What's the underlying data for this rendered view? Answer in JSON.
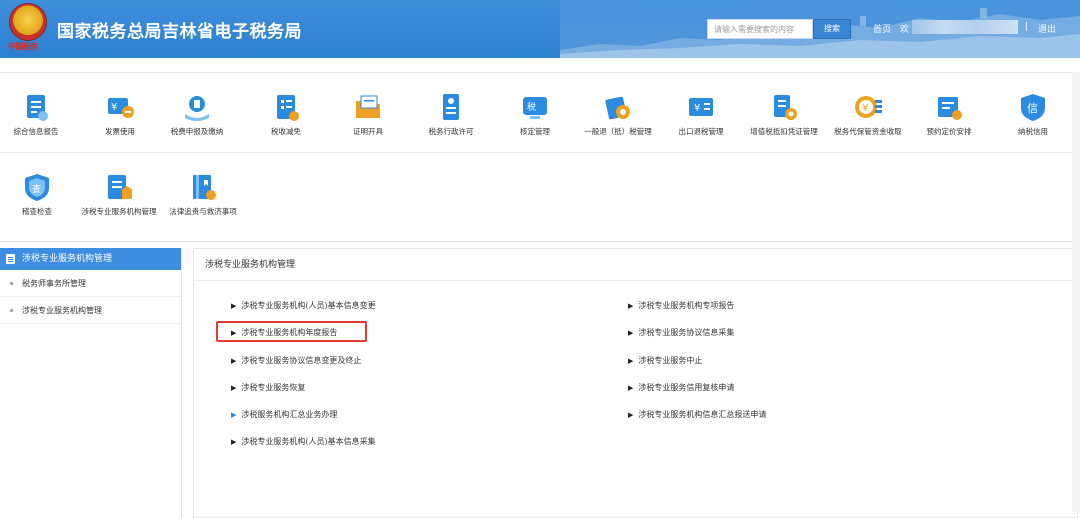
{
  "header": {
    "site_title": "国家税务总局吉林省电子税务局",
    "emblem_caption": "中国税务",
    "search_placeholder": "请输入需要搜索的内容",
    "search_button": "搜索",
    "nav_home": "首页",
    "nav_user_prefix": "欢",
    "nav_separator": "|",
    "nav_logout": "退出"
  },
  "toolbar": {
    "row1": [
      {
        "label": "综合信息报告",
        "icon": "report-icon",
        "color": "#2a8be0"
      },
      {
        "label": "发票使用",
        "icon": "invoice-icon",
        "color": "#2a8be0"
      },
      {
        "label": "税费申报及缴纳",
        "icon": "tax-declare-icon",
        "color": "#2a8be0"
      },
      {
        "label": "税收减免",
        "icon": "tax-reduction-icon",
        "color": "#2a8be0"
      },
      {
        "label": "证明开具",
        "icon": "certificate-icon",
        "color": "#f0a020"
      },
      {
        "label": "税务行政许可",
        "icon": "admin-license-icon",
        "color": "#2a8be0"
      },
      {
        "label": "核定管理",
        "icon": "assessment-icon",
        "color": "#2a8be0"
      },
      {
        "label": "一般退（抵）税管理",
        "icon": "refund-icon",
        "color": "#2a8be0"
      },
      {
        "label": "出口退税管理",
        "icon": "export-refund-icon",
        "color": "#2a8be0"
      },
      {
        "label": "增值税抵扣凭证管理",
        "icon": "vat-voucher-icon",
        "color": "#2a8be0"
      },
      {
        "label": "税务代保管资金收取",
        "icon": "custody-fund-icon",
        "color": "#f0a020"
      },
      {
        "label": "预约定价安排",
        "icon": "pricing-arrangement-icon",
        "color": "#2a8be0"
      },
      {
        "label": "纳税信用",
        "icon": "credit-icon",
        "color": "#2a8be0"
      }
    ],
    "row2": [
      {
        "label": "稽查检查",
        "icon": "inspection-icon",
        "color": "#2a8be0"
      },
      {
        "label": "涉税专业服务机构管理",
        "icon": "agency-management-icon",
        "color": "#2a8be0"
      },
      {
        "label": "法律追责与救济事项",
        "icon": "legal-remedy-icon",
        "color": "#2a8be0"
      }
    ]
  },
  "sidebar": {
    "header": "涉税专业服务机构管理",
    "items": [
      {
        "label": "税务师事务所管理"
      },
      {
        "label": "涉税专业服务机构管理"
      }
    ]
  },
  "panel": {
    "title": "涉税专业服务机构管理",
    "left_links": [
      {
        "label": "涉税专业服务机构(人员)基本信息变更"
      },
      {
        "label": "涉税专业服务机构年度报告",
        "highlighted": true
      },
      {
        "label": "涉税专业服务协议信息变更及终止"
      },
      {
        "label": "涉税专业服务恢复"
      },
      {
        "label": "涉税服务机构汇总业务办理",
        "accent": true
      },
      {
        "label": "涉税专业服务机构(人员)基本信息采集"
      }
    ],
    "right_links": [
      {
        "label": "涉税专业服务机构专项报告"
      },
      {
        "label": "涉税专业服务协议信息采集"
      },
      {
        "label": "涉税专业服务中止"
      },
      {
        "label": "涉税专业服务信用复核申请"
      },
      {
        "label": "涉税专业服务机构信息汇总报送申请"
      }
    ]
  },
  "colors": {
    "header_blue": "#3f8fdc",
    "sidebar_active": "#3d8ee0",
    "highlight_red": "#e33a2e",
    "icon_blue": "#2a8be0",
    "icon_orange": "#f0a020"
  }
}
